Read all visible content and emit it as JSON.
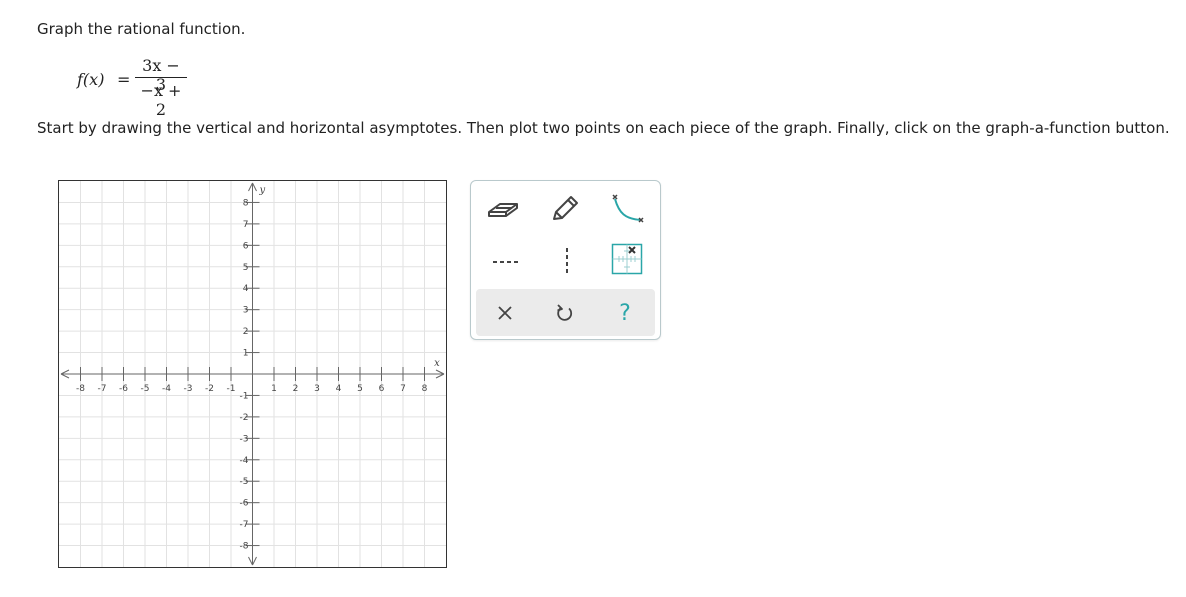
{
  "instructions": {
    "title": "Graph the rational function.",
    "steps": "Start by drawing the vertical and horizontal asymptotes. Then plot two points on each piece of the graph. Finally, click on the graph-a-function button."
  },
  "function": {
    "name": "f(x)",
    "equals": "=",
    "numerator": "3x − 3",
    "denominator": "−x + 2"
  },
  "graph": {
    "x_axis_label": "x",
    "y_axis_label": "y",
    "x_range": [
      -9,
      9
    ],
    "y_range": [
      -9,
      9
    ],
    "x_tick_labels": [
      "-8",
      "-7",
      "-6",
      "-5",
      "-4",
      "-3",
      "-2",
      "-1",
      "1",
      "2",
      "3",
      "4",
      "5",
      "6",
      "7",
      "8"
    ],
    "y_tick_labels_positive": [
      "8",
      "7",
      "6",
      "5",
      "4",
      "3",
      "2",
      "1"
    ],
    "y_tick_labels_negative": [
      "-1",
      "-2",
      "-3",
      "-4",
      "-5",
      "-6",
      "-7",
      "-8"
    ],
    "grid": true
  },
  "toolbar": {
    "tools": [
      {
        "name": "eraser-tool",
        "icon": "eraser-icon"
      },
      {
        "name": "pencil-tool",
        "icon": "pencil-icon"
      },
      {
        "name": "graph-a-function-tool",
        "icon": "curve-icon"
      },
      {
        "name": "horizontal-asymptote-tool",
        "icon": "horizontal-dashed-line-icon"
      },
      {
        "name": "vertical-asymptote-tool",
        "icon": "vertical-dashed-line-icon"
      },
      {
        "name": "point-tool",
        "icon": "grid-point-icon"
      }
    ],
    "actions": [
      {
        "name": "clear-all-button",
        "icon": "close-icon"
      },
      {
        "name": "undo-button",
        "icon": "undo-icon"
      },
      {
        "name": "help-button",
        "icon": "help-icon",
        "label": "?"
      }
    ],
    "accent_color": "#2aa6a8"
  }
}
